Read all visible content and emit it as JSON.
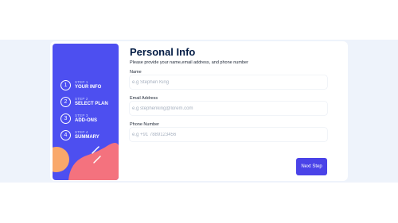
{
  "sidebar": {
    "steps": [
      {
        "number": "1",
        "label": "STEP 1",
        "title": "YOUR INFO"
      },
      {
        "number": "2",
        "label": "STEP 2",
        "title": "SELECT PLAN"
      },
      {
        "number": "3",
        "label": "STEP 3",
        "title": "ADD-ONS"
      },
      {
        "number": "4",
        "label": "STEP 4",
        "title": "SUMMARY"
      }
    ]
  },
  "form": {
    "title": "Personal Info",
    "subtitle": "Please provide your name,email address, and phone number",
    "fields": [
      {
        "label": "Name",
        "value": "",
        "placeholder": "e.g Stephen King"
      },
      {
        "label": "Email Address",
        "value": "",
        "placeholder": "e.g stephenking@lorem.com"
      },
      {
        "label": "Phone Number",
        "value": "",
        "placeholder": "e.g +91 7889123456"
      }
    ],
    "next_label": "Next Step"
  },
  "colors": {
    "sidebar": "#4d4ff0",
    "accent": "#4a43e8",
    "title": "#021b44",
    "blob_orange": "#f9a86a",
    "blob_pink": "#f4727e"
  }
}
